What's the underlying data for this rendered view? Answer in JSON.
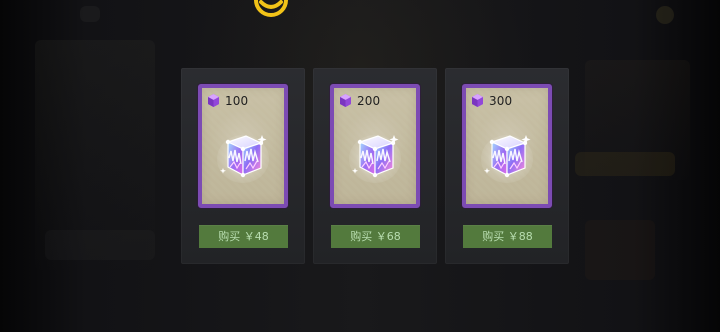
{
  "shop": {
    "items": [
      {
        "amount": "100",
        "price_label": "购买 ￥48"
      },
      {
        "amount": "200",
        "price_label": "购买 ￥68"
      },
      {
        "amount": "300",
        "price_label": "购买 ￥88"
      }
    ]
  },
  "icons": {
    "top_emblem": "smile-icon",
    "gem": "gem-icon",
    "box": "crystal-box-icon"
  },
  "colors": {
    "accent_yellow": "#f2c318",
    "card_bg": "#2a2b2f",
    "card_border": "#7c4bb3",
    "buy_button": "#537a3d",
    "buy_text": "#b8ddb0"
  }
}
